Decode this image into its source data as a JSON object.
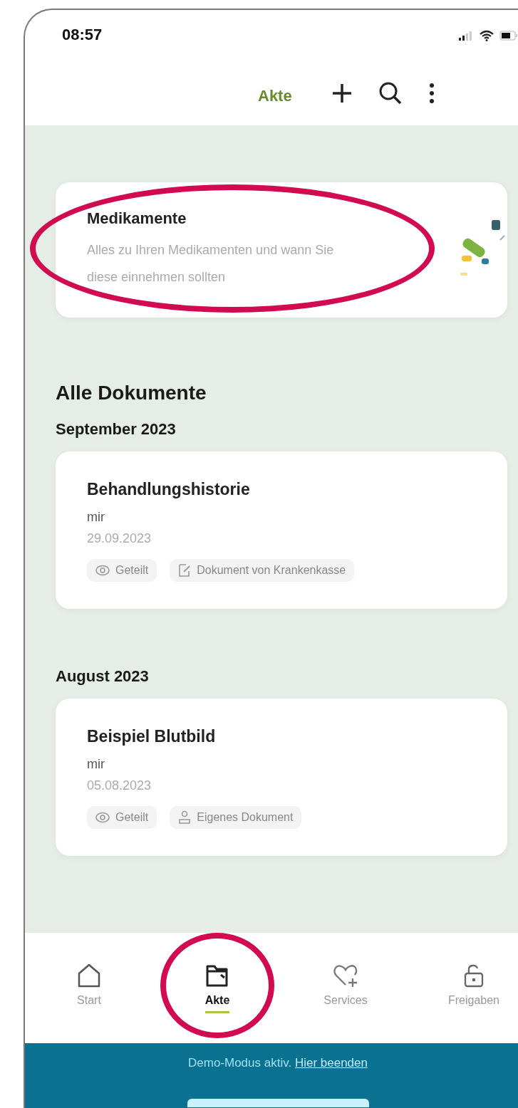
{
  "status_bar": {
    "time": "08:57"
  },
  "header": {
    "title": "Akte"
  },
  "medication_card": {
    "title": "Medikamente",
    "description": "Alles zu Ihren Medikamenten und wann Sie diese einnehmen sollten",
    "highlighted": true
  },
  "section_title": "Alle Dokumente",
  "groups": [
    {
      "month": "September 2023",
      "documents": [
        {
          "title": "Behandlungshistorie",
          "author": "mir",
          "date": "29.09.2023",
          "tags": [
            {
              "kind": "shared",
              "label": "Geteilt"
            },
            {
              "kind": "insurer",
              "label": "Dokument von Krankenkasse"
            }
          ]
        }
      ]
    },
    {
      "month": "August 2023",
      "documents": [
        {
          "title": "Beispiel Blutbild",
          "author": "mir",
          "date": "05.08.2023",
          "tags": [
            {
              "kind": "shared",
              "label": "Geteilt"
            },
            {
              "kind": "own",
              "label": "Eigenes Dokument"
            }
          ]
        }
      ]
    }
  ],
  "nav": [
    {
      "kind": "home",
      "label": "Start",
      "selected": false,
      "highlighted": false
    },
    {
      "kind": "folder",
      "label": "Akte",
      "selected": true,
      "highlighted": true
    },
    {
      "kind": "heart",
      "label": "Services",
      "selected": false,
      "highlighted": false
    },
    {
      "kind": "lock",
      "label": "Freigaben",
      "selected": false,
      "highlighted": false
    }
  ],
  "demo_banner": {
    "text": "Demo-Modus aktiv.",
    "link": "Hier beenden"
  }
}
